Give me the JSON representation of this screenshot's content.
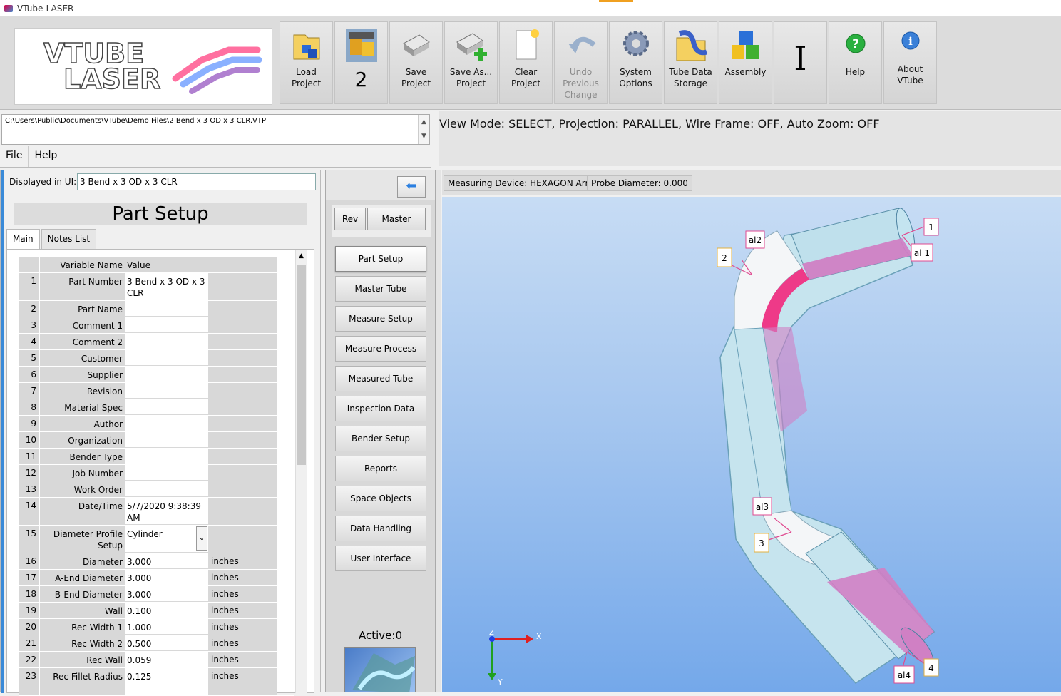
{
  "app": {
    "title": "VTube-LASER"
  },
  "toolbar": {
    "logo_text_top": "VTUBE",
    "logo_text_bottom": "LASER",
    "load": "Load\nProject",
    "camera_number": "2",
    "save": "Save\nProject",
    "save_as": "Save As...\nProject",
    "clear": "Clear\nProject",
    "undo": "Undo\nPrevious\nChange",
    "system": "System\nOptions",
    "tubedata": "Tube Data\nStorage",
    "assembly": "Assembly",
    "cursor_glyph": "I",
    "help": "Help",
    "about": "About\nVTube"
  },
  "file_path": "C:\\Users\\Public\\Documents\\VTube\\Demo Files\\2 Bend x 3 OD x 3 CLR.VTP",
  "menu": {
    "file": "File",
    "help": "Help"
  },
  "view_mode": "View Mode: SELECT, Projection: PARALLEL, Wire Frame: OFF, Auto Zoom: OFF",
  "left": {
    "displayed_label": "Displayed in UI:",
    "displayed_value": "3 Bend x 3 OD x 3 CLR",
    "title": "Part Setup",
    "tabs": [
      "Main",
      "Notes List"
    ],
    "columns": {
      "name": "Variable Name",
      "value": "Value"
    },
    "rows": [
      {
        "n": "1",
        "name": "Part Number",
        "value": "3 Bend x 3 OD x 3 CLR",
        "unit": ""
      },
      {
        "n": "2",
        "name": "Part Name",
        "value": "",
        "unit": ""
      },
      {
        "n": "3",
        "name": "Comment 1",
        "value": "",
        "unit": ""
      },
      {
        "n": "4",
        "name": "Comment 2",
        "value": "",
        "unit": ""
      },
      {
        "n": "5",
        "name": "Customer",
        "value": "",
        "unit": ""
      },
      {
        "n": "6",
        "name": "Supplier",
        "value": "",
        "unit": ""
      },
      {
        "n": "7",
        "name": "Revision",
        "value": "",
        "unit": ""
      },
      {
        "n": "8",
        "name": "Material Spec",
        "value": "",
        "unit": ""
      },
      {
        "n": "9",
        "name": "Author",
        "value": "",
        "unit": ""
      },
      {
        "n": "10",
        "name": "Organization",
        "value": "",
        "unit": ""
      },
      {
        "n": "11",
        "name": "Bender Type",
        "value": "",
        "unit": ""
      },
      {
        "n": "12",
        "name": "Job Number",
        "value": "",
        "unit": ""
      },
      {
        "n": "13",
        "name": "Work Order",
        "value": "",
        "unit": ""
      },
      {
        "n": "14",
        "name": "Date/Time",
        "value": "5/7/2020 9:38:39 AM",
        "unit": ""
      },
      {
        "n": "15",
        "name": "Diameter Profile Setup",
        "value": "Cylinder",
        "unit": "",
        "dropdown": true
      },
      {
        "n": "16",
        "name": "Diameter",
        "value": "3.000",
        "unit": "inches"
      },
      {
        "n": "17",
        "name": "A-End Diameter",
        "value": "3.000",
        "unit": "inches"
      },
      {
        "n": "18",
        "name": "B-End Diameter",
        "value": "3.000",
        "unit": "inches"
      },
      {
        "n": "19",
        "name": "Wall",
        "value": "0.100",
        "unit": "inches"
      },
      {
        "n": "20",
        "name": "Rec Width 1",
        "value": "1.000",
        "unit": "inches"
      },
      {
        "n": "21",
        "name": "Rec Width 2",
        "value": "0.500",
        "unit": "inches"
      },
      {
        "n": "22",
        "name": "Rec Wall",
        "value": "0.059",
        "unit": "inches"
      },
      {
        "n": "23",
        "name": "Rec Fillet Radius",
        "value": "0.125",
        "unit": "inches"
      }
    ]
  },
  "mid": {
    "back_glyph": "⬅",
    "rev": "Rev",
    "master": "Master",
    "buttons": [
      "Part Setup",
      "Master Tube",
      "Measure Setup",
      "Measure Process",
      "Measured Tube",
      "Inspection Data",
      "Bender Setup",
      "Reports",
      "Space Objects",
      "Data Handling",
      "User Interface"
    ],
    "active_label": "Active:0"
  },
  "viewport": {
    "device": "Measuring Device: HEXAGON Arm",
    "probe": "Probe Diameter: 0.000",
    "labels": {
      "n1": "1",
      "n2": "2",
      "n3": "3",
      "n4": "4",
      "al1": "al 1",
      "al2": "al2",
      "al3": "al3",
      "al4": "al4"
    },
    "axis_x": "X",
    "axis_y": "Y",
    "axis_z": "Z"
  },
  "colors": {
    "accent": "#3a8ad8",
    "tube": "#c0e2ee",
    "deviation_pink": "#d880c4",
    "deviation_red": "#ee3a88"
  }
}
